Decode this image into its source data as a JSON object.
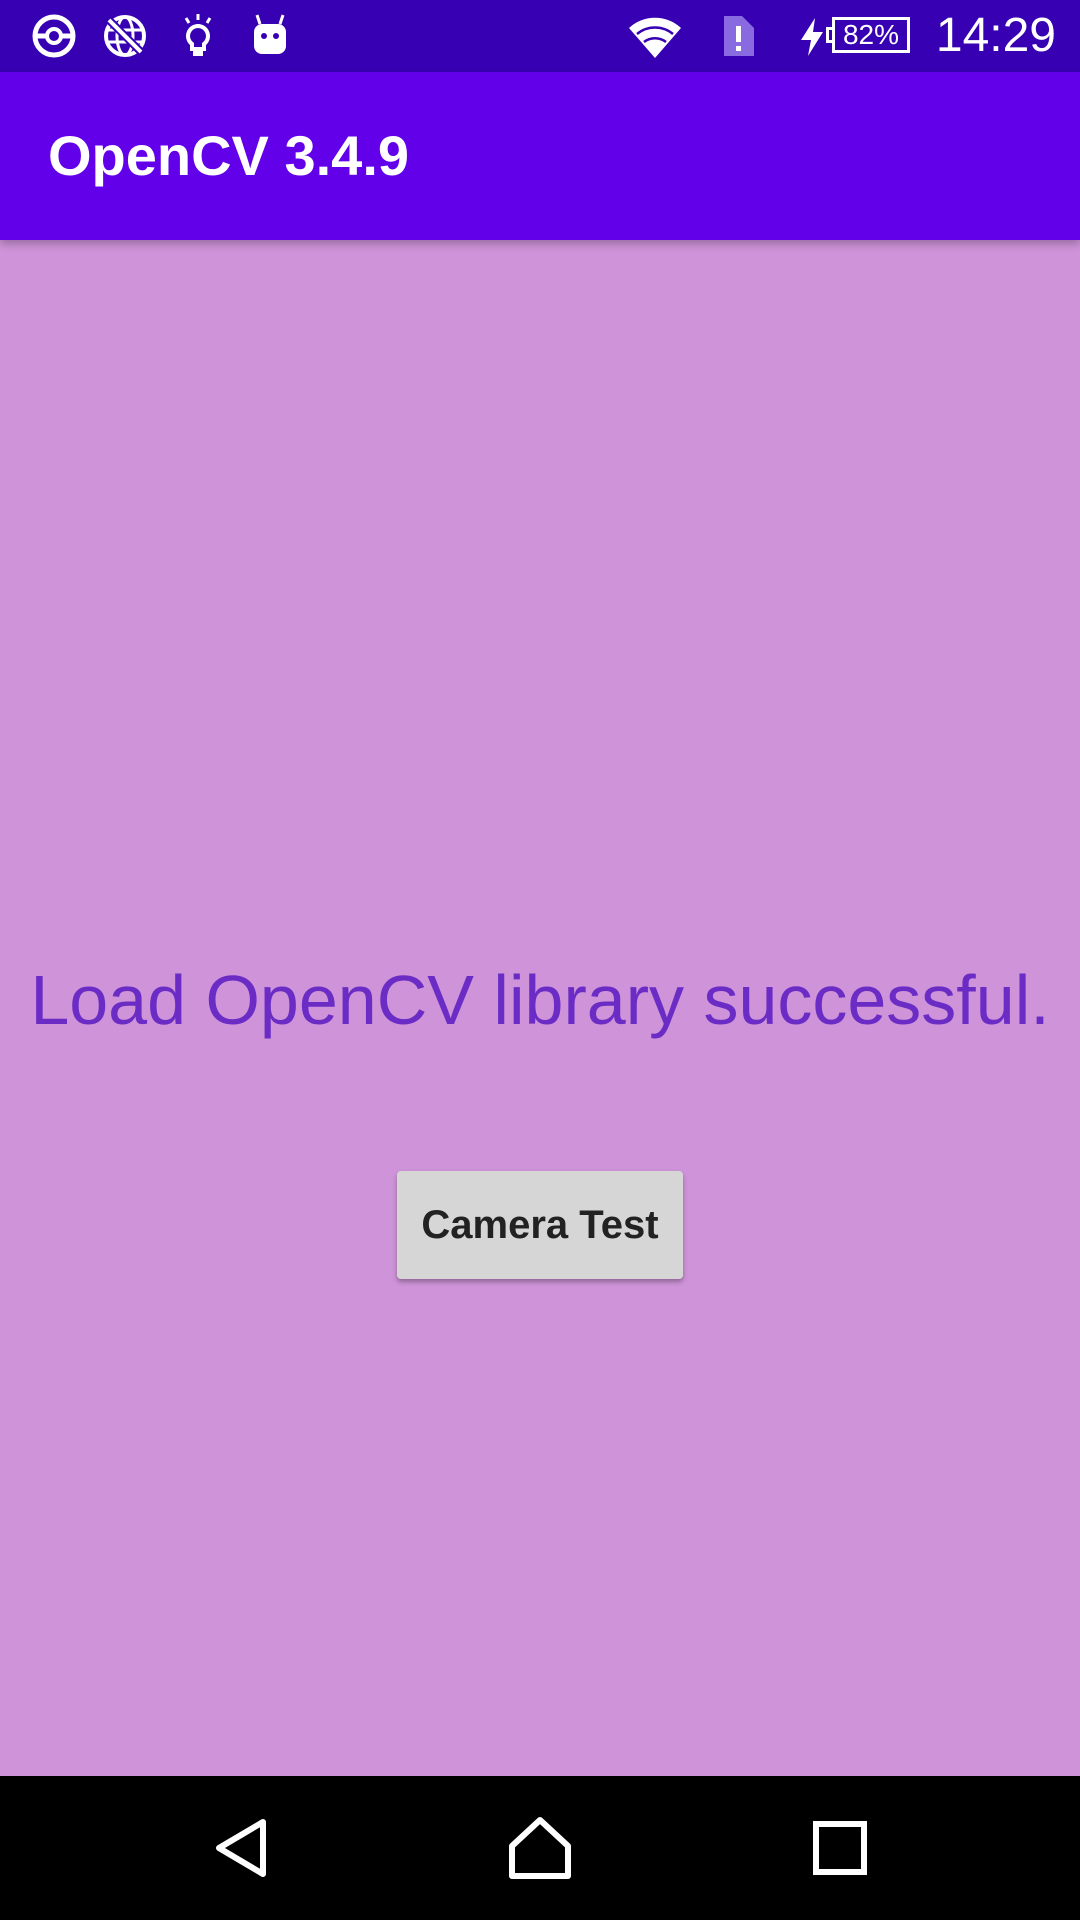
{
  "status_bar": {
    "icons_left": [
      "pokeball-icon",
      "no-network-globe-icon",
      "lightbulb-icon",
      "android-robot-icon"
    ],
    "icons_right": [
      "wifi-icon",
      "sim-alert-icon",
      "charging-bolt-icon",
      "battery-icon"
    ],
    "battery_percent": "82%",
    "time": "14:29",
    "background_color": "#3700b3"
  },
  "app_bar": {
    "title": "OpenCV 3.4.9",
    "background_color": "#6200ea"
  },
  "main": {
    "message": "Load OpenCV library successful.",
    "camera_button_label": "Camera Test",
    "background_color": "#ce93d8",
    "message_color": "#6a2cc5"
  },
  "nav_bar": {
    "buttons": [
      "back-icon",
      "home-icon",
      "recents-icon"
    ]
  }
}
